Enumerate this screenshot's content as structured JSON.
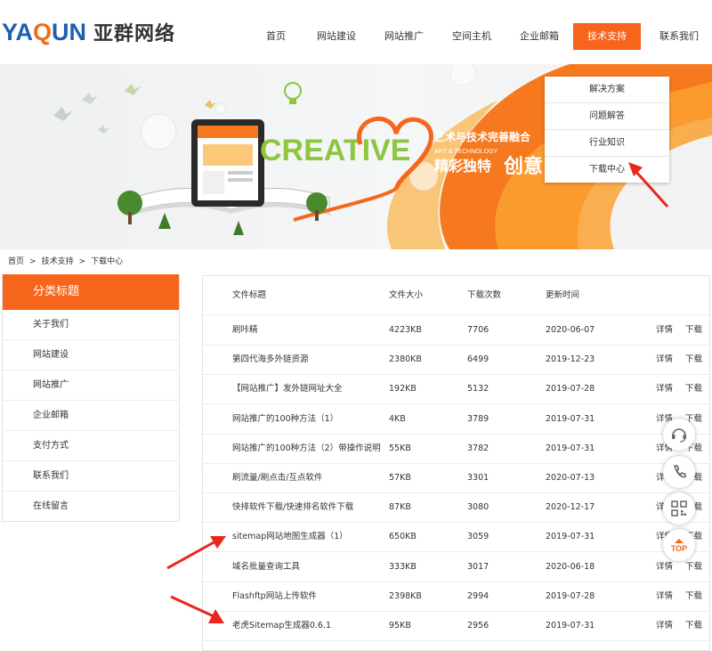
{
  "logo": {
    "en_prefix": "YA",
    "en_q": "Q",
    "en_suffix": "UN",
    "cn": "亚群网络"
  },
  "nav": [
    {
      "label": "首页"
    },
    {
      "label": "网站建设"
    },
    {
      "label": "网站推广"
    },
    {
      "label": "空间主机"
    },
    {
      "label": "企业邮箱"
    },
    {
      "label": "技术支持",
      "active": true
    },
    {
      "label": "联系我们"
    }
  ],
  "dropdown": [
    "解决方案",
    "问题解答",
    "行业知识",
    "下载中心"
  ],
  "banner": {
    "creative": "CREATIVE",
    "slogan1": "艺术与技术完善融合",
    "slogan_en": "ART & TECHNOLOGY",
    "slogan2": "精彩独特",
    "slogan3": "创意"
  },
  "breadcrumb": [
    "首页",
    "技术支持",
    "下载中心"
  ],
  "breadcrumb_sep": ">",
  "sidebar": {
    "title": "分类标题",
    "items": [
      "关于我们",
      "网站建设",
      "网站推广",
      "企业邮箱",
      "支付方式",
      "联系我们",
      "在线留言"
    ]
  },
  "table": {
    "headers": [
      "文件标题",
      "文件大小",
      "下载次数",
      "更新时间"
    ],
    "rows": [
      {
        "title": "刷咔精",
        "size": "4223KB",
        "count": "7706",
        "date": "2020-06-07"
      },
      {
        "title": "第四代海多外链资源",
        "size": "2380KB",
        "count": "6499",
        "date": "2019-12-23"
      },
      {
        "title": "【网站推广】发外链网址大全",
        "size": "192KB",
        "count": "5132",
        "date": "2019-07-28"
      },
      {
        "title": "网站推广的100种方法（1）",
        "size": "4KB",
        "count": "3789",
        "date": "2019-07-31"
      },
      {
        "title": "网站推广的100种方法（2）带操作说明",
        "size": "55KB",
        "count": "3782",
        "date": "2019-07-31"
      },
      {
        "title": "刷流量/刷点击/互点软件",
        "size": "57KB",
        "count": "3301",
        "date": "2020-07-13"
      },
      {
        "title": "快排软件下载/快速排名软件下载",
        "size": "87KB",
        "count": "3080",
        "date": "2020-12-17"
      },
      {
        "title": "sitemap网站地图生成器（1）",
        "size": "650KB",
        "count": "3059",
        "date": "2019-07-31"
      },
      {
        "title": "域名批量查询工具",
        "size": "333KB",
        "count": "3017",
        "date": "2020-06-18"
      },
      {
        "title": "Flashftp网站上传软件",
        "size": "2398KB",
        "count": "2994",
        "date": "2019-07-28"
      },
      {
        "title": "老虎Sitemap生成器0.6.1",
        "size": "95KB",
        "count": "2956",
        "date": "2019-07-31"
      }
    ],
    "detail_label": "详情",
    "download_label": "下载"
  },
  "float_top_label": "TOP",
  "colors": {
    "accent": "#f7651c",
    "logo_blue": "#1d5fb0",
    "arrow": "#e8261c"
  }
}
